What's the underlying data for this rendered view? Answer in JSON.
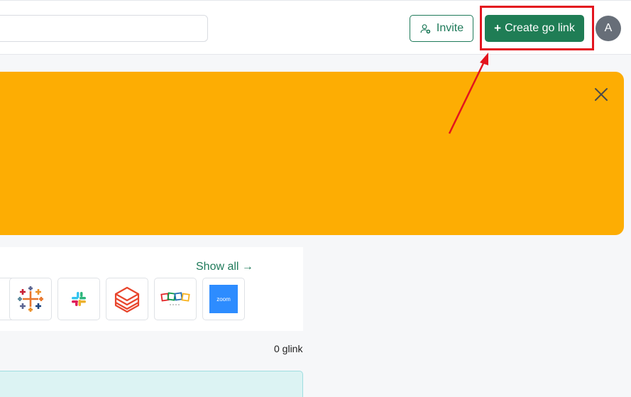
{
  "header": {
    "invite_label": "Invite",
    "create_plus": "+",
    "create_label": "Create go link",
    "avatar_initial": "A"
  },
  "apps": {
    "show_all_label": "Show all →",
    "tiles": [
      "tableau-icon",
      "slack-icon",
      "databricks-icon",
      "zoho-icon",
      "zoom-icon"
    ],
    "zoom_text": "zoom"
  },
  "stats": {
    "glink_count": "0 glink"
  },
  "colors": {
    "accent_green": "#1f7d55",
    "banner_orange": "#fdad03",
    "highlight_red": "#e3141e"
  }
}
